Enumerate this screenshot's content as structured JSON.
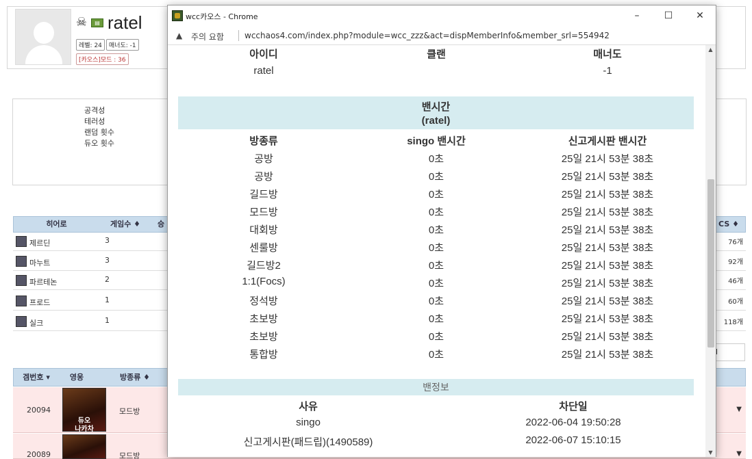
{
  "background": {
    "profile": {
      "username": "ratel",
      "level_badge": "레벨: 24",
      "manner_badge": "매너도: -1",
      "mode_badge": "[카오스]모드 : 36"
    },
    "stats_labels": [
      "공격성",
      "테러성",
      "랜덤 횟수",
      "듀오 횟수"
    ],
    "hero_table": {
      "headers": [
        "히어로",
        "게임수 ♦",
        "승",
        "CS ♦"
      ],
      "rows": [
        {
          "name": "제르딘",
          "games": "3",
          "side": "76개"
        },
        {
          "name": "마누트",
          "games": "3",
          "side": "92개"
        },
        {
          "name": "파르테논",
          "games": "2",
          "side": "46개"
        },
        {
          "name": "프로드",
          "games": "1",
          "side": "60개"
        },
        {
          "name": "실크",
          "games": "1",
          "side": "118개"
        }
      ]
    },
    "small_input_value": "l",
    "game_table": {
      "headers": [
        "겜번호 ▾",
        "영웅",
        "방종류 ♦"
      ],
      "rows": [
        {
          "id": "20094",
          "hero_label_1": "듀오",
          "hero_label_2": "나카차",
          "type": "모드방"
        },
        {
          "id": "20089",
          "type": "모드방"
        }
      ]
    }
  },
  "popup": {
    "window_title": "wcc카오스 - Chrome",
    "minimize": "–",
    "maximize": "☐",
    "close": "✕",
    "warning_text": "주의 요함",
    "url": "wcchaos4.com/index.php?module=wcc_zzz&act=dispMemberInfo&member_srl=554942",
    "member_info": {
      "headers": [
        "아이디",
        "클랜",
        "매너도"
      ],
      "values": [
        "ratel",
        "",
        "-1"
      ]
    },
    "ban_time": {
      "title": "밴시간",
      "subtitle": "(ratel)",
      "headers": [
        "방종류",
        "singo 밴시간",
        "신고게시판 밴시간"
      ],
      "rows": [
        [
          "공방",
          "0초",
          "25일 21시 53분 38초"
        ],
        [
          "공방",
          "0초",
          "25일 21시 53분 38초"
        ],
        [
          "길드방",
          "0초",
          "25일 21시 53분 38초"
        ],
        [
          "모드방",
          "0초",
          "25일 21시 53분 38초"
        ],
        [
          "대회방",
          "0초",
          "25일 21시 53분 38초"
        ],
        [
          "센룰방",
          "0초",
          "25일 21시 53분 38초"
        ],
        [
          "길드방2",
          "0초",
          "25일 21시 53분 38초"
        ],
        [
          "1:1(Focs)",
          "0초",
          "25일 21시 53분 38초"
        ],
        [
          "정석방",
          "0초",
          "25일 21시 53분 38초"
        ],
        [
          "초보방",
          "0초",
          "25일 21시 53분 38초"
        ],
        [
          "초보방",
          "0초",
          "25일 21시 53분 38초"
        ],
        [
          "통합방",
          "0초",
          "25일 21시 53분 38초"
        ]
      ]
    },
    "ban_info": {
      "title": "밴정보",
      "headers": [
        "사유",
        "차단일"
      ],
      "rows": [
        [
          "singo",
          "2022-06-04 19:50:28"
        ],
        [
          "신고게시판(패드립)(1490589)",
          "2022-06-07 15:10:15"
        ]
      ]
    }
  }
}
